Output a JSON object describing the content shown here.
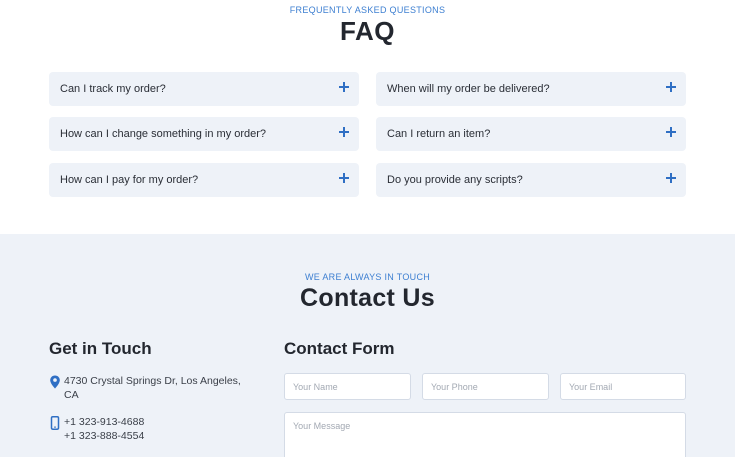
{
  "faq": {
    "eyebrow": "FREQUENTLY ASKED QUESTIONS",
    "title": "FAQ",
    "items": [
      {
        "question": "Can I track my order?"
      },
      {
        "question": "When will my order be delivered?"
      },
      {
        "question": "How can I change something in my order?"
      },
      {
        "question": "Can I return an item?"
      },
      {
        "question": "How can I pay for my order?"
      },
      {
        "question": "Do you provide any scripts?"
      }
    ]
  },
  "contact": {
    "eyebrow": "WE ARE ALWAYS IN TOUCH",
    "title": "Contact Us",
    "get_in_touch": {
      "heading": "Get in Touch",
      "address_line1": "4730 Crystal Springs Dr, Los Angeles,",
      "address_line2": "CA",
      "phone1": "+1 323-913-4688",
      "phone2": "+1 323-888-4554",
      "icons": [
        "map-pin-icon",
        "phone-icon"
      ]
    },
    "form": {
      "heading": "Contact Form",
      "name_placeholder": "Your Name",
      "phone_placeholder": "Your Phone",
      "email_placeholder": "Your Email",
      "message_placeholder": "Your Message"
    }
  },
  "colors": {
    "accent": "#3d7fd1",
    "card_bg": "#eef2f8",
    "heading": "#23272f"
  }
}
